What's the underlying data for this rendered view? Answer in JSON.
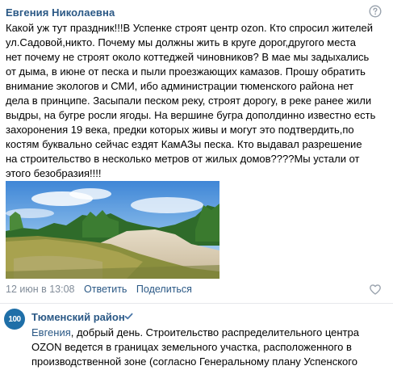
{
  "comment": {
    "author": "Евгения Николаевна",
    "text_lines": [
      "Какой уж тут праздник!!!В Успенке строят центр ozon. Кто спросил жителей",
      "ул.Садовой,никто. Почему мы должны жить в круге дорог,другого места",
      "нет почему не строят около коттеджей чиновников? В мае мы задыхались",
      "от дыма, в июне от песка и пыли проезжающих камазов. Прошу обратить",
      "внимание экологов и СМИ, ибо администрации тюменского района нет",
      "дела в принципе. Засыпали песком реку, строят дорогу, в реке ранее жили",
      "выдры, на бугре росли ягоды. На вершине бугра дополдинно известно есть",
      "захоронения 19 века, предки которых живы и могут это подтвердить,по",
      "костям буквально сейчас ездят КамАЗы песка. Кто выдавал разрешение",
      "на строительство в несколько метров от жилых домов????Мы устали от",
      "этого безобразия!!!!"
    ],
    "date": "12 июн в 13:08",
    "reply_label": "Ответить",
    "share_label": "Поделиться",
    "icons": {
      "help": "help-circle-icon",
      "like": "heart-icon"
    }
  },
  "reply": {
    "author": "Тюменский район",
    "avatar_text": "100",
    "mention": "Евгения",
    "text_lines": [
      ", добрый день. Строительство распределительного центра",
      "OZON ведется в границах земельного участка, расположенного в",
      "производственной зоне (согласно Генеральному плану Успенского"
    ],
    "icons": {
      "verified": "verified-check-icon"
    }
  },
  "colors": {
    "link": "#2a5885",
    "meta": "#818c99",
    "divider": "#e7e8ec",
    "avatar": "#1f6fa8"
  }
}
